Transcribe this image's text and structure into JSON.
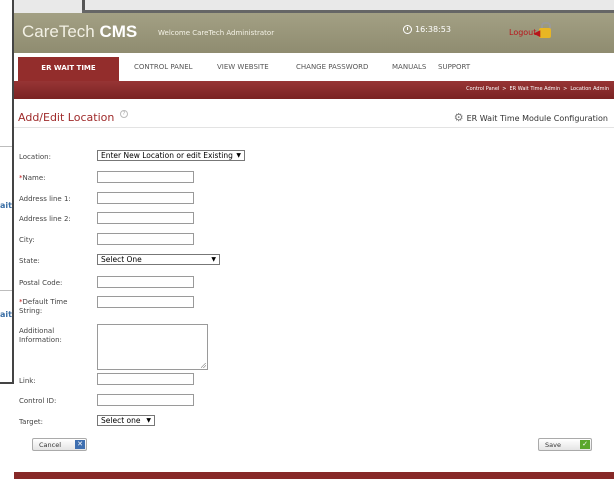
{
  "header": {
    "logo_light": "CareTech ",
    "logo_bold": "CMS",
    "welcome": "Welcome CareTech Administrator",
    "time": "16:38:53",
    "logout": "Logout"
  },
  "nav": {
    "items": [
      "ER WAIT TIME",
      "CONTROL PANEL",
      "VIEW WEBSITE",
      "CHANGE PASSWORD",
      "MANUALS",
      "SUPPORT"
    ]
  },
  "breadcrumb": [
    "Control Panel",
    ">",
    "ER Wait Time Admin",
    ">",
    "Location Admin"
  ],
  "page": {
    "title": "Add/Edit Location",
    "config_link": "ER Wait Time Module Configuration"
  },
  "form": {
    "location_label": "Location:",
    "location_value": "Enter New Location or edit Existing",
    "name_req": "*",
    "name_label": "Name:",
    "address1_label": "Address line 1:",
    "address2_label": "Address line 2:",
    "city_label": "City:",
    "state_label": "State:",
    "state_value": "Select One",
    "postal_label": "Postal Code:",
    "default_time_req": "*",
    "default_time_label": "Default Time String:",
    "additional_label": "Additional Information:",
    "link_label": "Link:",
    "control_id_label": "Control ID:",
    "target_label": "Target:",
    "target_value": "Select one",
    "cancel": "Cancel",
    "save": "Save"
  },
  "background": {
    "side_text_1": "ait",
    "side_text_2": "ait"
  },
  "colors": {
    "brand_red": "#932d2c",
    "header_olive": "#9a977b",
    "save_green": "#5aa72c",
    "cancel_blue": "#3f6fb0"
  }
}
